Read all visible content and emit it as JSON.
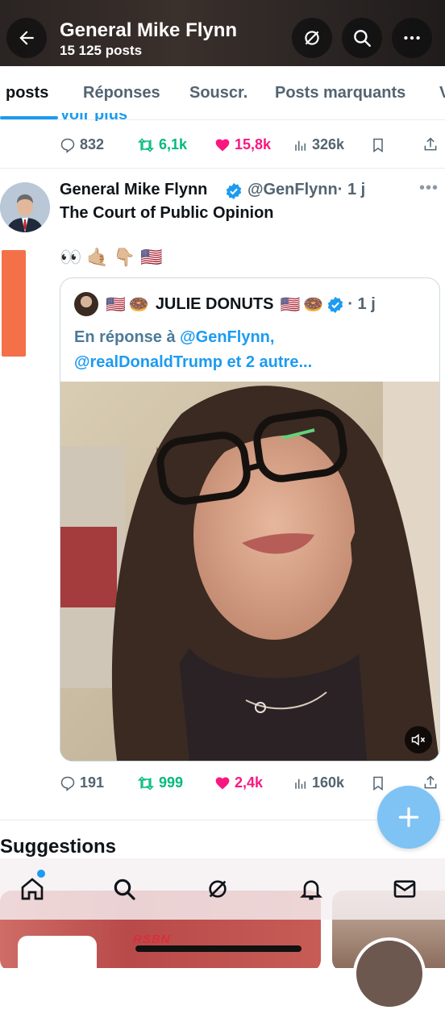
{
  "header": {
    "title": "General Mike Flynn",
    "subtitle": "15 125 posts",
    "back_icon": "arrow-left-icon",
    "grok_icon": "grok-icon",
    "search_icon": "search-icon",
    "more_icon": "more-horizontal-icon"
  },
  "tabs": [
    {
      "label": "posts",
      "active": true
    },
    {
      "label": "Réponses"
    },
    {
      "label": "Souscr."
    },
    {
      "label": "Posts marquants"
    },
    {
      "label": "V"
    }
  ],
  "prev_post": {
    "cut_text": "Voir plus",
    "stats": {
      "replies": "832",
      "reposts": "6,1k",
      "likes": "15,8k",
      "views": "326k"
    }
  },
  "post": {
    "author_name": "General Mike Flynn",
    "handle": "@GenFlynn",
    "time": "· 1 j",
    "text": "The Court of Public Opinion",
    "emojis": [
      "👀",
      "🤙🏼",
      "👇🏼",
      "🇺🇸"
    ],
    "quote": {
      "author_name": "JULIE DONUTS",
      "flag1": "🇺🇸",
      "donut1": "🍩",
      "flag2": "🇺🇸",
      "donut2": "🍩",
      "time": "· 1 j",
      "reply_prefix": "En réponse à ",
      "reply_handle": "@GenFlynn,",
      "reply_line2": "@realDonaldTrump et 2 autre..."
    },
    "stats": {
      "replies": "191",
      "reposts": "999",
      "likes": "2,4k",
      "views": "160k"
    }
  },
  "suggestions": {
    "title": "Suggestions",
    "card1_label": "RSBN"
  },
  "colors": {
    "accent": "#1d9bf0",
    "repost": "#00ba7c",
    "like": "#f91880",
    "muted": "#536471"
  },
  "bottom_nav": [
    "home-icon",
    "search-icon",
    "grok-icon",
    "bell-icon",
    "mail-icon"
  ]
}
